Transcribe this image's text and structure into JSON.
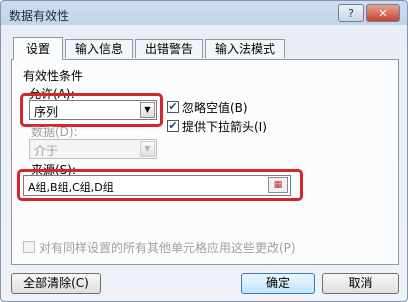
{
  "window": {
    "title": "数据有效性",
    "help_label": "?",
    "close_label": "✕"
  },
  "tabs": [
    {
      "label": "设置",
      "active": true
    },
    {
      "label": "输入信息",
      "active": false
    },
    {
      "label": "出错警告",
      "active": false
    },
    {
      "label": "输入法模式",
      "active": false
    }
  ],
  "settings": {
    "section_title": "有效性条件",
    "allow_label": "允许(A):",
    "allow_value": "序列",
    "ignore_blank_label": "忽略空值(B)",
    "ignore_blank_checked": true,
    "dropdown_label": "提供下拉箭头(I)",
    "dropdown_checked": true,
    "data_label": "数据(D):",
    "data_value": "介于",
    "source_label": "来源(S):",
    "source_value": "A组,B组,C组,D组",
    "apply_all_label": "对有同样设置的所有其他单元格应用这些更改(P)",
    "apply_all_checked": false
  },
  "buttons": {
    "clear_all": "全部清除(C)",
    "ok": "确定",
    "cancel": "取消"
  },
  "colors": {
    "highlight": "#d8252d",
    "primary_button": "#bee6fd"
  }
}
